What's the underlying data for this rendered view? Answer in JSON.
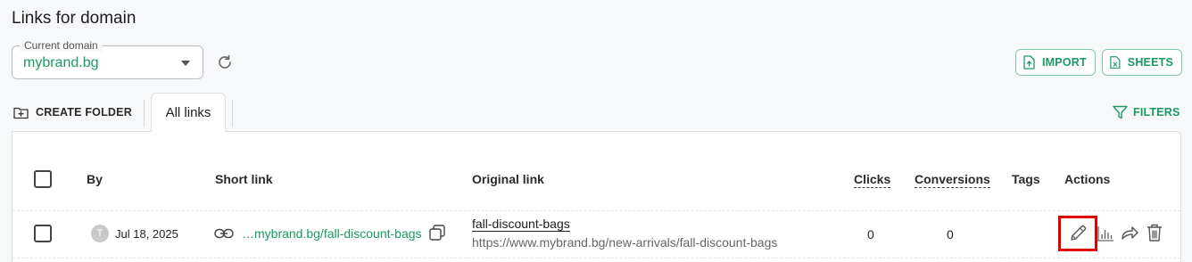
{
  "header": {
    "title": "Links for domain"
  },
  "domain_select": {
    "legend": "Current domain",
    "value": "mybrand.bg"
  },
  "actions": {
    "import_label": "IMPORT",
    "sheets_label": "SHEETS"
  },
  "toolbar": {
    "create_folder_label": "CREATE FOLDER",
    "tab_all_links": "All links",
    "filters_label": "FILTERS"
  },
  "table": {
    "columns": {
      "by": "By",
      "short_link": "Short link",
      "original_link": "Original link",
      "clicks": "Clicks",
      "conversions": "Conversions",
      "tags": "Tags",
      "actions": "Actions"
    },
    "rows": [
      {
        "avatar_initial": "T",
        "date": "Jul 18, 2025",
        "short_link": "…mybrand.bg/fall-discount-bags",
        "original_title": "fall-discount-bags",
        "original_url": "https://www.mybrand.bg/new-arrivals/fall-discount-bags",
        "clicks": "0",
        "conversions": "0"
      }
    ]
  },
  "colors": {
    "accent": "#1a9a62",
    "highlight": "#e00000"
  },
  "icons": [
    "refresh-icon",
    "import-file-icon",
    "sheets-file-icon",
    "create-folder-icon",
    "filter-icon",
    "link-icon",
    "copy-icon",
    "edit-pencil-icon",
    "stats-chart-icon",
    "share-icon",
    "trash-icon"
  ]
}
